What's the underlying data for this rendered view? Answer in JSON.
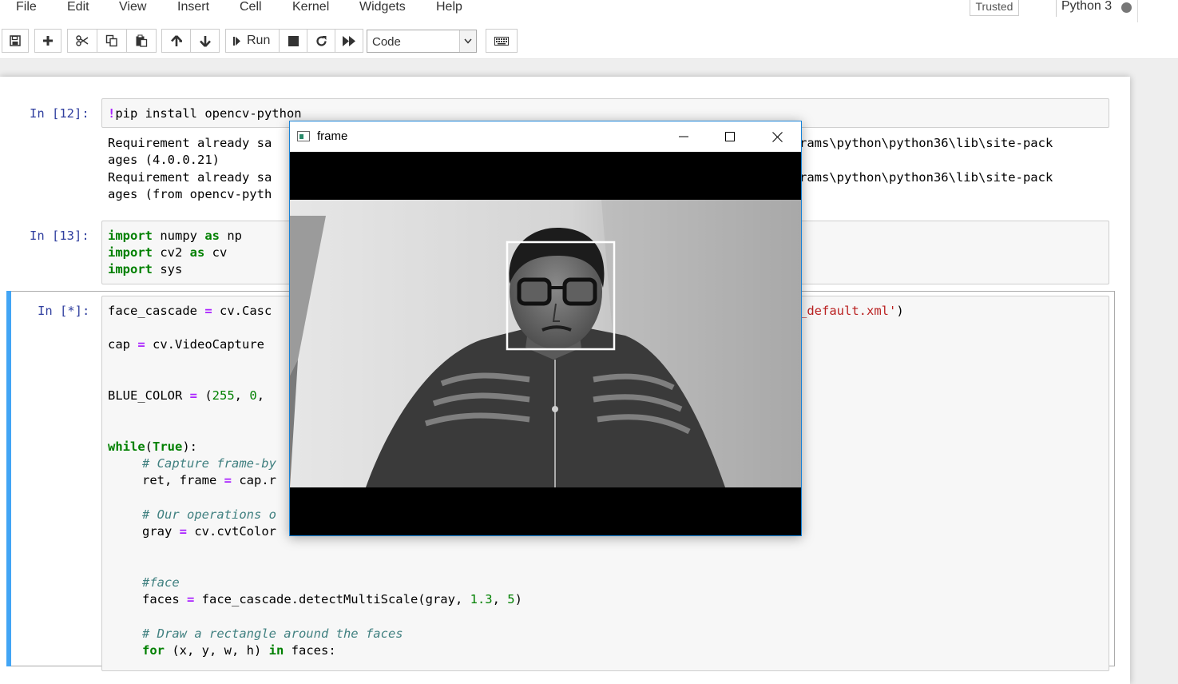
{
  "menu": [
    "File",
    "Edit",
    "View",
    "Insert",
    "Cell",
    "Kernel",
    "Widgets",
    "Help"
  ],
  "status": {
    "trusted": "Trusted",
    "kernel": "Python 3"
  },
  "toolbar": {
    "run_label": "Run",
    "cell_type": "Code",
    "icons": [
      "save-icon",
      "plus-icon",
      "cut-icon",
      "copy-icon",
      "paste-icon",
      "arrow-up-icon",
      "arrow-down-icon",
      "run-icon",
      "stop-icon",
      "restart-icon",
      "fast-forward-icon",
      "keyboard-icon"
    ]
  },
  "cells": {
    "c12": {
      "prompt": "In [12]:",
      "code_bang": "!",
      "code_rest": "pip install opencv-python",
      "output": [
        "Requirement already sa",
        "ages (4.0.0.21)",
        "Requirement already sa",
        "ages (from opencv-pyth",
        "rams\\python\\python36\\lib\\site-pack",
        "rams\\python\\python36\\lib\\site-pack"
      ]
    },
    "c13": {
      "prompt": "In [13]:",
      "l1_kw": "import",
      "l1_mod": " numpy ",
      "l1_as": "as",
      "l1_alias": " np",
      "l2_kw": "import",
      "l2_mod": " cv2 ",
      "l2_as": "as",
      "l2_alias": " cv",
      "l3_kw": "import",
      "l3_mod": " sys"
    },
    "running": {
      "prompt": "In [*]:",
      "l1a": "face_cascade ",
      "l1op": "=",
      "l1b": " cv.Casc",
      "l1str": "_default.xml'",
      "l1c": ")",
      "l2a": "cap ",
      "l2op": "=",
      "l2b": " cv.VideoCapture",
      "l3a": "BLUE_COLOR ",
      "l3op": "=",
      "l3b": " (",
      "l3n1": "255",
      "l3c": ", ",
      "l3n2": "0",
      "l3d": ",",
      "l4kw": "while",
      "l4a": "(",
      "l4kw2": "True",
      "l4b": "):",
      "l5cm": "# Capture frame-by",
      "l6a": "ret, frame ",
      "l6op": "=",
      "l6b": " cap.r",
      "l7cm": "# Our operations o",
      "l8a": "gray ",
      "l8op": "=",
      "l8b": " cv.cvtColor",
      "l9cm": "#face",
      "l10a": "faces ",
      "l10op": "=",
      "l10b": " face_cascade.detectMultiScale(gray, ",
      "l10n1": "1.3",
      "l10c": ", ",
      "l10n2": "5",
      "l10d": ")",
      "l11cm": "# Draw a rectangle around the faces",
      "l12kw": "for",
      "l12a": " (x, y, w, h) ",
      "l12kw2": "in",
      "l12b": " faces:"
    }
  },
  "frame_window": {
    "title": "frame"
  },
  "colors": {
    "prompt": "#303f9f",
    "keyword": "#008000",
    "operator": "#aa22ff",
    "string": "#ba2121",
    "comment": "#408080",
    "running_bar": "#42a5f5",
    "window_border": "#1883d7"
  }
}
